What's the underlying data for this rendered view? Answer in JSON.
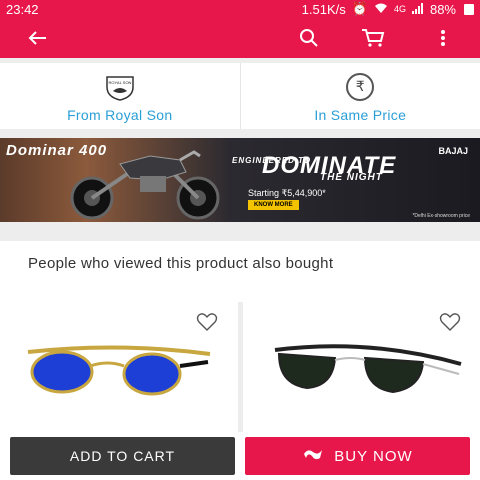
{
  "status_bar": {
    "time": "23:42",
    "network_speed": "1.51K/s",
    "network_type": "4G",
    "battery": "88%"
  },
  "app_bar": {
    "icons": [
      "back-arrow-icon",
      "search-icon",
      "cart-icon",
      "more-vert-icon"
    ]
  },
  "assurances": [
    {
      "label": "From Royal Son",
      "icon": "royal-son-badge-icon",
      "badge_text": "ROYAL SON"
    },
    {
      "label": "In Same Price",
      "icon": "rupee-icon",
      "icon_glyph": "₹"
    }
  ],
  "banner": {
    "brand_text": "Dominar 400",
    "headline_top": "ENGINEERED TO",
    "headline_main": "DOMINATE",
    "headline_bottom": "THE NIGHT",
    "price_text": "Starting ₹5,44,900*",
    "cta": "KNOW MORE",
    "footnote": "*Delhi Ex-showroom price",
    "logo_text": "BAJAJ"
  },
  "recommendations": {
    "title": "People who viewed this product also bought",
    "products": [
      {
        "image": "blue-mirrored-round-sunglasses",
        "lens_color": "#1e3fd6",
        "frame_color": "#c8a640",
        "wishlisted": false
      },
      {
        "image": "green-clubmaster-sunglasses",
        "lens_color": "#1f2a1f",
        "frame_color": "#222222",
        "wishlisted": false
      }
    ]
  },
  "actions": {
    "add_to_cart": "ADD TO CART",
    "buy_now": "BUY NOW"
  },
  "colors": {
    "brand": "#e8174b",
    "accent_text": "#2a9fd6",
    "dark_button": "#3a3a3a"
  }
}
